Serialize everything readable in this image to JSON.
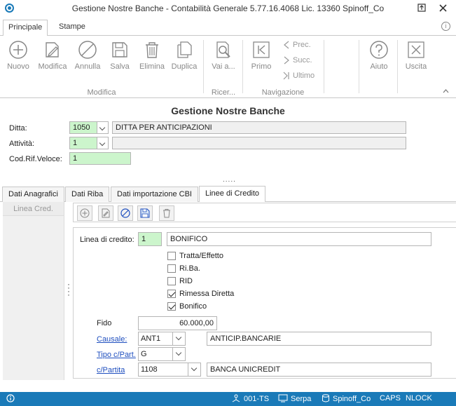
{
  "window": {
    "title": "Gestione Nostre Banche - Contabilità Generale 5.77.16.4068 Lic. 13360 Spinoff_Co",
    "pin_icon": "pin-icon",
    "close_icon": "close-icon"
  },
  "ribbon_tabs": [
    "Principale",
    "Stampe"
  ],
  "ribbon": {
    "modifica": {
      "group_label": "Modifica",
      "buttons": [
        "Nuovo",
        "Modifica",
        "Annulla",
        "Salva",
        "Elimina",
        "Duplica"
      ]
    },
    "ricerca": {
      "group_label": "Ricer...",
      "button": "Vai a..."
    },
    "navigazione": {
      "group_label": "Navigazione",
      "primo": "Primo",
      "prec": "Prec.",
      "succ": "Succ.",
      "ultimo": "Ultimo"
    },
    "aiuto": "Aiuto",
    "uscita": "Uscita"
  },
  "form": {
    "title": "Gestione Nostre Banche",
    "ditta": {
      "label": "Ditta:",
      "code": "1050",
      "description": "DITTA PER ANTICIPAZIONI"
    },
    "attivita": {
      "label": "Attività:",
      "code": "1",
      "description": ""
    },
    "cod_rif": {
      "label": "Cod.Rif.Veloce:",
      "value": "1"
    },
    "grip": "....."
  },
  "tabs": [
    "Dati Anagrafici",
    "Dati Riba",
    "Dati importazione CBI",
    "Linee di Credito"
  ],
  "left_pane": {
    "header": "Linea Cred."
  },
  "detail": {
    "linea_label": "Linea di credito:",
    "linea_code": "1",
    "linea_desc": "BONIFICO",
    "checkboxes": [
      {
        "label": "Tratta/Effetto",
        "checked": false
      },
      {
        "label": "Ri.Ba.",
        "checked": false
      },
      {
        "label": "RID",
        "checked": false
      },
      {
        "label": "Rimessa Diretta",
        "checked": true
      },
      {
        "label": "Bonifico",
        "checked": true
      }
    ],
    "fido_label": "Fido",
    "fido_value": "60.000,00",
    "causale_label": "Causale:",
    "causale_code": "ANT1",
    "causale_desc": "ANTICIP.BANCARIE",
    "tipo_label": "Tipo c/Part.",
    "tipo_value": "G",
    "cpartita_label": "c/Partita",
    "cpartita_code": "1108",
    "cpartita_desc": "BANCA UNICREDIT"
  },
  "status": {
    "items": [
      "001-TS",
      "Serpa",
      "Spinoff_Co",
      "CAPS",
      "NLOCK"
    ],
    "accent": "#1a7ab8"
  }
}
